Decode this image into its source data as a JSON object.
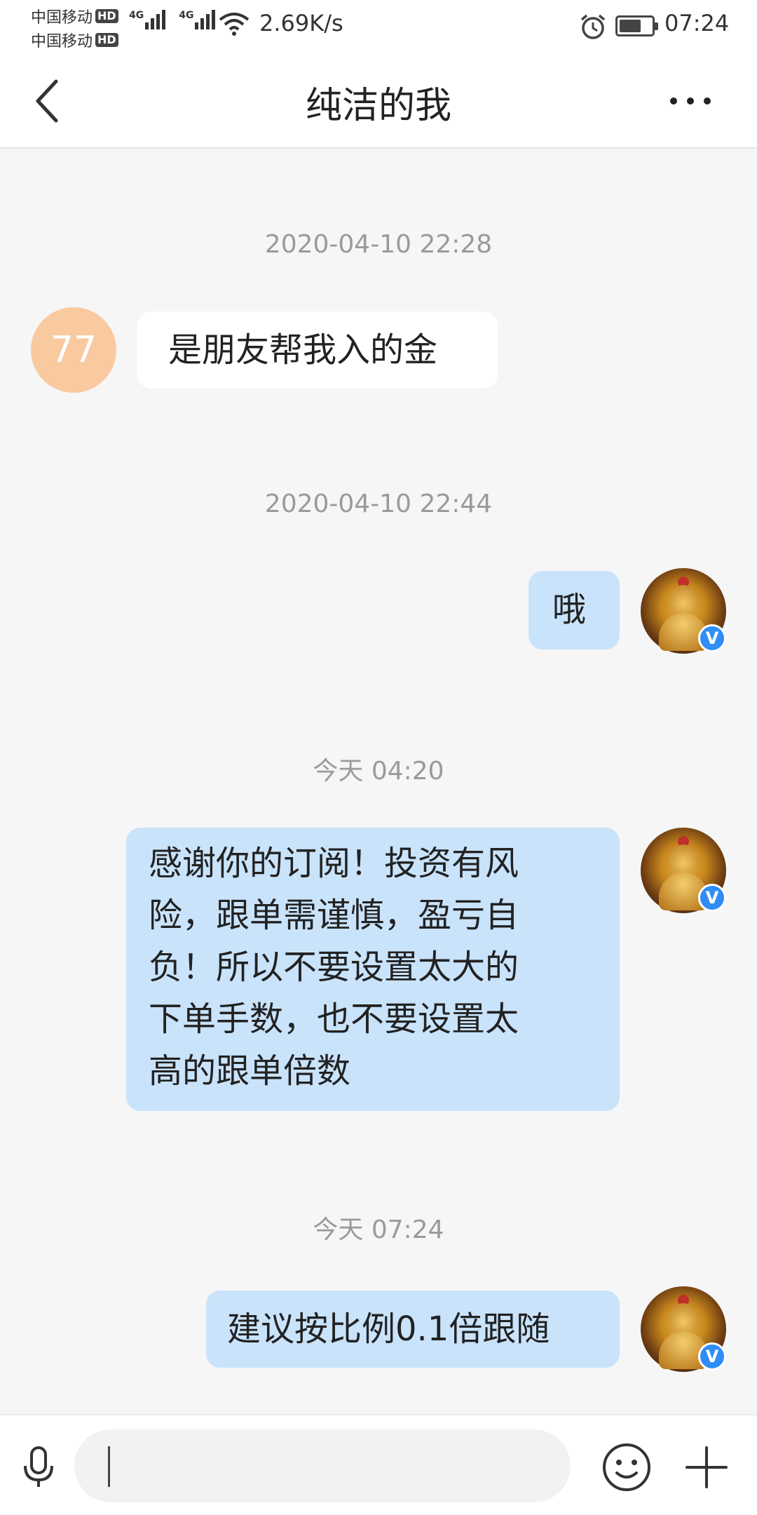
{
  "status_bar": {
    "carrier_1": "中国移动",
    "carrier_2": "中国移动",
    "hd_1": "HD",
    "hd_2": "HD",
    "net_1": "4G",
    "net_2": "4G",
    "speed": "2.69K/s",
    "time": "07:24",
    "icons": [
      "signal-icon",
      "wifi-icon",
      "alarm-icon",
      "battery-icon"
    ]
  },
  "header": {
    "title": "纯洁的我",
    "back_icon": "chevron-left-icon",
    "more_icon": "more-dots-icon"
  },
  "messages": [
    {
      "timestamp": "2020-04-10 22:28"
    },
    {
      "side": "left",
      "avatar_text": "77",
      "text": "是朋友帮我入的金"
    },
    {
      "timestamp": "2020-04-10 22:44"
    },
    {
      "side": "right",
      "text": "哦"
    },
    {
      "timestamp": "今天 04:20"
    },
    {
      "side": "right",
      "lines": [
        "感谢你的订阅！投资有风",
        "险，跟单需谨慎，盈亏自",
        "负！所以不要设置太大的",
        "下单手数，也不要设置太",
        "高的跟单倍数"
      ]
    },
    {
      "timestamp": "今天 07:24"
    },
    {
      "side": "right",
      "text": "建议按比例0.1倍跟随"
    }
  ],
  "self_avatar": {
    "badge": "V"
  },
  "input_bar": {
    "value": "",
    "icons": [
      "microphone-icon",
      "emoji-icon",
      "plus-icon"
    ]
  },
  "colors": {
    "background": "#f6f6f6",
    "bubble_self": "#c9e3fb",
    "bubble_other": "#ffffff",
    "avatar_77": "#f9c9a0",
    "verified_badge": "#2f8df5",
    "timestamp": "#9a9a9a"
  }
}
